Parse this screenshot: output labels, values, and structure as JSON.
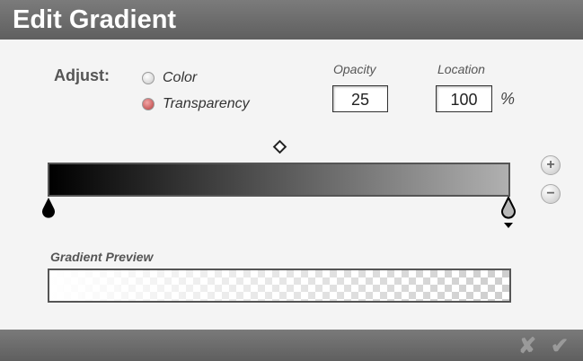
{
  "dialog": {
    "title": "Edit Gradient"
  },
  "adjust": {
    "label": "Adjust:",
    "options": [
      {
        "label": "Color",
        "selected": false
      },
      {
        "label": "Transparency",
        "selected": true
      }
    ]
  },
  "opacity": {
    "label": "Opacity",
    "value": "25"
  },
  "location": {
    "label": "Location",
    "value": "100",
    "unit": "%"
  },
  "gradient": {
    "start_color": "#000000",
    "end_color": "#b0b0b0"
  },
  "buttons": {
    "add": "+",
    "remove": "−",
    "cancel": "✘",
    "confirm": "✔"
  },
  "preview": {
    "label": "Gradient Preview"
  }
}
